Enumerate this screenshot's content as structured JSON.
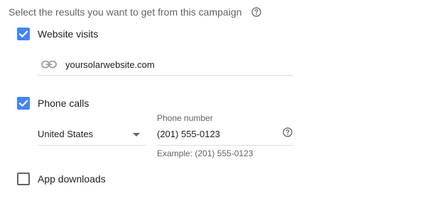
{
  "header": {
    "instruction": "Select the results you want to get from this campaign",
    "help_icon": "help-circle-icon"
  },
  "website_visits": {
    "label": "Website visits",
    "checked": true,
    "link_icon": "link-icon",
    "url_value": "yoursolarwebsite.com"
  },
  "phone_calls": {
    "label": "Phone calls",
    "checked": true,
    "country_selected": "United States",
    "dropdown_icon": "dropdown-arrow-icon",
    "phone_label": "Phone number",
    "phone_value": "(201) 555-0123",
    "phone_help_icon": "help-circle-icon",
    "phone_hint": "Example: (201) 555-0123"
  },
  "app_downloads": {
    "label": "App downloads",
    "checked": false
  },
  "colors": {
    "checkbox_accent": "#4285f4",
    "muted_text": "#5f6368",
    "underline": "#dadce0"
  }
}
